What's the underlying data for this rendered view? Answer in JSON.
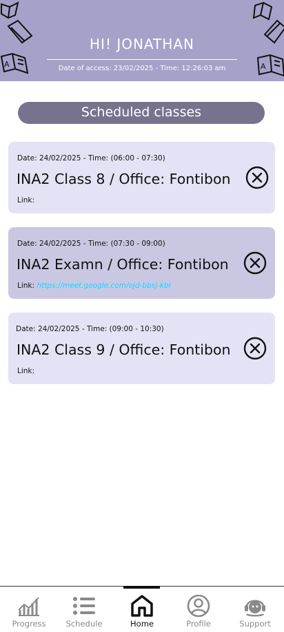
{
  "header": {
    "greeting": "HI! JONATHAN",
    "access_text": "Date of access: 23/02/2025 - Time: 12:26:03 am"
  },
  "section_title": "Scheduled classes",
  "classes": [
    {
      "meta": "Date: 24/02/2025 - Time: (06:00 - 07:30)",
      "title": "INA2 Class 8 / Office: Fontibon",
      "link_label": "Link:",
      "link_url": ""
    },
    {
      "meta": "Date: 24/02/2025 - Time: (07:30 - 09:00)",
      "title": "INA2 Examn / Office: Fontibon",
      "link_label": "Link:",
      "link_url": "https://meet.google.com/ojd-bbsj-kbi"
    },
    {
      "meta": "Date: 24/02/2025 - Time: (09:00 - 10:30)",
      "title": "INA2 Class 9 / Office: Fontibon",
      "link_label": "Link:",
      "link_url": ""
    }
  ],
  "nav": [
    {
      "label": "Progress",
      "icon": "chart-icon",
      "active": false
    },
    {
      "label": "Schedule",
      "icon": "list-icon",
      "active": false
    },
    {
      "label": "Home",
      "icon": "home-icon",
      "active": true
    },
    {
      "label": "Profile",
      "icon": "user-icon",
      "active": false
    },
    {
      "label": "Support",
      "icon": "support-icon",
      "active": false
    }
  ],
  "colors": {
    "header_bg": "#a6a1c9",
    "pill_bg": "#77738f",
    "card_light": "#e4e3f5",
    "card_dark": "#cac7e2",
    "link": "#2ec4ff"
  }
}
